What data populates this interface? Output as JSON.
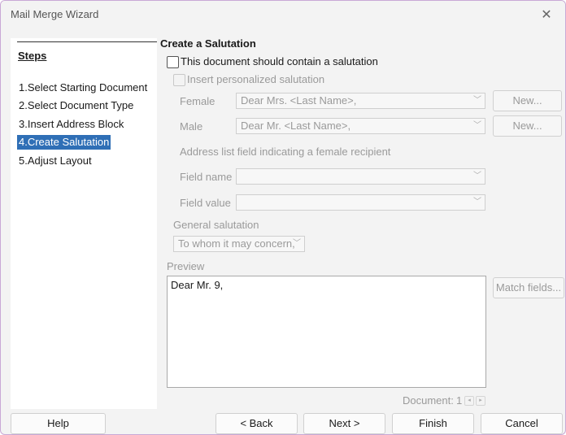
{
  "window": {
    "title": "Mail Merge Wizard",
    "close_glyph": "✕"
  },
  "steps": {
    "heading": "Steps",
    "items": [
      {
        "label": "1.Select Starting Document"
      },
      {
        "label": "2.Select Document Type"
      },
      {
        "label": "3.Insert Address Block"
      },
      {
        "label": "4.Create Salutation",
        "active": true
      },
      {
        "label": "5.Adjust Layout"
      }
    ]
  },
  "main": {
    "heading": "Create a Salutation",
    "contain_salutation": {
      "label": "This document should contain a salutation",
      "checked": false
    },
    "personalized": {
      "label": "Insert personalized salutation",
      "checked": false,
      "enabled": false
    },
    "female": {
      "label": "Female",
      "value": "Dear Mrs. <Last Name>,",
      "new_button": "New..."
    },
    "male": {
      "label": "Male",
      "value": "Dear Mr. <Last Name>,",
      "new_button": "New..."
    },
    "address_field_caption": "Address list field indicating a female recipient",
    "field_name": {
      "label": "Field name",
      "value": ""
    },
    "field_value": {
      "label": "Field value",
      "value": ""
    },
    "general_salutation": {
      "label": "General salutation",
      "value": "To whom it may concern,"
    },
    "preview": {
      "label": "Preview",
      "text": "Dear Mr. 9,",
      "match_fields_button": "Match fields..."
    },
    "document_counter": {
      "label": "Document:",
      "value": "1"
    }
  },
  "footer": {
    "help": "Help",
    "back": "< Back",
    "next": "Next >",
    "finish": "Finish",
    "cancel": "Cancel"
  },
  "colors": {
    "selection": "#2f6fb6",
    "window_border": "#c9a8d6"
  }
}
